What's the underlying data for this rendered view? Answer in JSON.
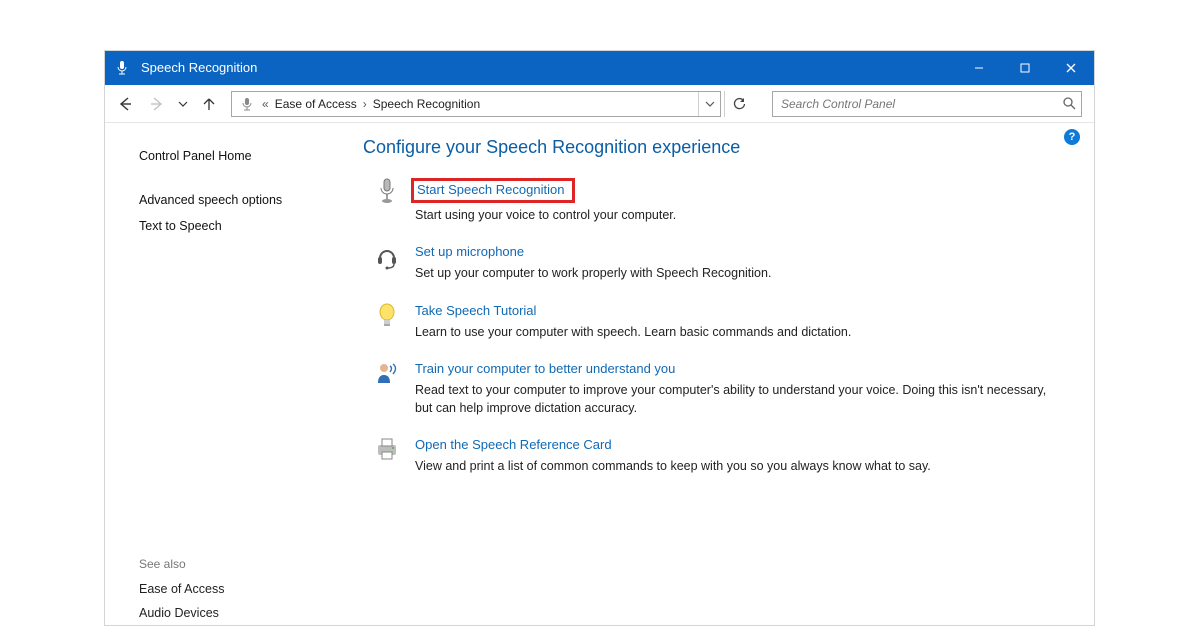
{
  "titlebar": {
    "title": "Speech Recognition"
  },
  "address": {
    "prefix": "«",
    "crumb1": "Ease of Access",
    "sep": "›",
    "crumb2": "Speech Recognition"
  },
  "search": {
    "placeholder": "Search Control Panel"
  },
  "help_badge": "?",
  "left_nav": {
    "home": "Control Panel Home",
    "adv": "Advanced speech options",
    "tts": "Text to Speech"
  },
  "see_also": {
    "heading": "See also",
    "ease": "Ease of Access",
    "audio": "Audio Devices"
  },
  "heading": "Configure your Speech Recognition experience",
  "tasks": [
    {
      "link": "Start Speech Recognition",
      "desc": "Start using your voice to control your computer."
    },
    {
      "link": "Set up microphone",
      "desc": "Set up your computer to work properly with Speech Recognition."
    },
    {
      "link": "Take Speech Tutorial",
      "desc": "Learn to use your computer with speech.  Learn basic commands and dictation."
    },
    {
      "link": "Train your computer to better understand you",
      "desc": "Read text to your computer to improve your computer's ability to understand your voice.  Doing this isn't necessary, but can help improve dictation accuracy."
    },
    {
      "link": "Open the Speech Reference Card",
      "desc": "View and print a list of common commands to keep with you so you always know what to say."
    }
  ]
}
